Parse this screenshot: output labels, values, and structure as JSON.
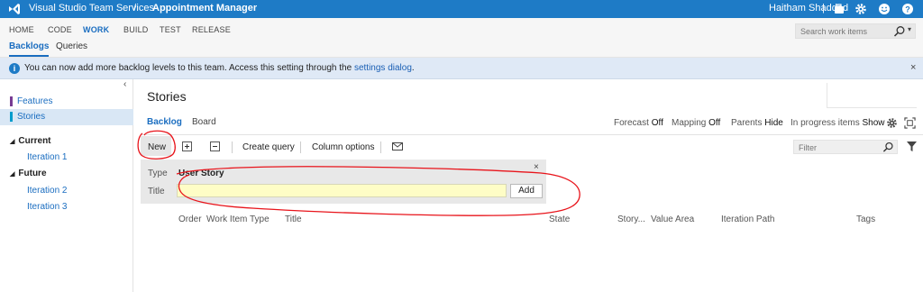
{
  "topbar": {
    "product": "Visual Studio Team Services",
    "separator": "/",
    "project": "Appointment Manager",
    "user": "Haitham Shaddad",
    "divider": "|"
  },
  "hubs": [
    "HOME",
    "CODE",
    "WORK",
    "BUILD",
    "TEST",
    "RELEASE"
  ],
  "active_hub": "WORK",
  "subtabs": [
    "Backlogs",
    "Queries"
  ],
  "search": {
    "placeholder": "Search work items"
  },
  "banner": {
    "text": "You can now add more backlog levels to this team. Access this setting through the ",
    "link": "settings dialog",
    "end": "."
  },
  "sidebar": {
    "collapse_glyph": "‹",
    "backlogs": [
      {
        "label": "Features",
        "color": "#773b93"
      },
      {
        "label": "Stories",
        "color": "#009ccc",
        "selected": true
      }
    ],
    "groups": [
      {
        "label": "Current",
        "iterations": [
          "Iteration 1"
        ]
      },
      {
        "label": "Future",
        "iterations": [
          "Iteration 2",
          "Iteration 3"
        ]
      }
    ]
  },
  "main": {
    "title": "Stories",
    "pivots": [
      "Backlog",
      "Board"
    ],
    "options": {
      "forecast_label": "Forecast",
      "forecast_value": "Off",
      "mapping_label": "Mapping",
      "mapping_value": "Off",
      "parents_label": "Parents",
      "parents_value": "Hide",
      "inprogress_label": "In progress items",
      "inprogress_value": "Show"
    },
    "toolbar": {
      "new": "New",
      "create_query": "Create query",
      "column_options": "Column options"
    },
    "filter": {
      "placeholder": "Filter"
    },
    "add_panel": {
      "type_label": "Type",
      "type_value": "User Story",
      "title_label": "Title",
      "title_value": "",
      "add_button": "Add",
      "close_glyph": "×"
    },
    "columns": [
      "Order",
      "Work Item Type",
      "Title",
      "State",
      "Story...",
      "Value Area",
      "Iteration Path",
      "Tags"
    ]
  },
  "colors": {
    "topbar": "#1e7bc6",
    "accent": "#1a6dc0",
    "annotation": "#e8141b"
  },
  "icons": [
    "vsts-logo-icon",
    "briefcase-icon",
    "gear-icon",
    "smiley-icon",
    "help-icon",
    "search-icon",
    "info-icon",
    "expand-icon",
    "collapse-icon",
    "mail-icon",
    "filter-funnel-icon",
    "fullscreen-icon"
  ]
}
